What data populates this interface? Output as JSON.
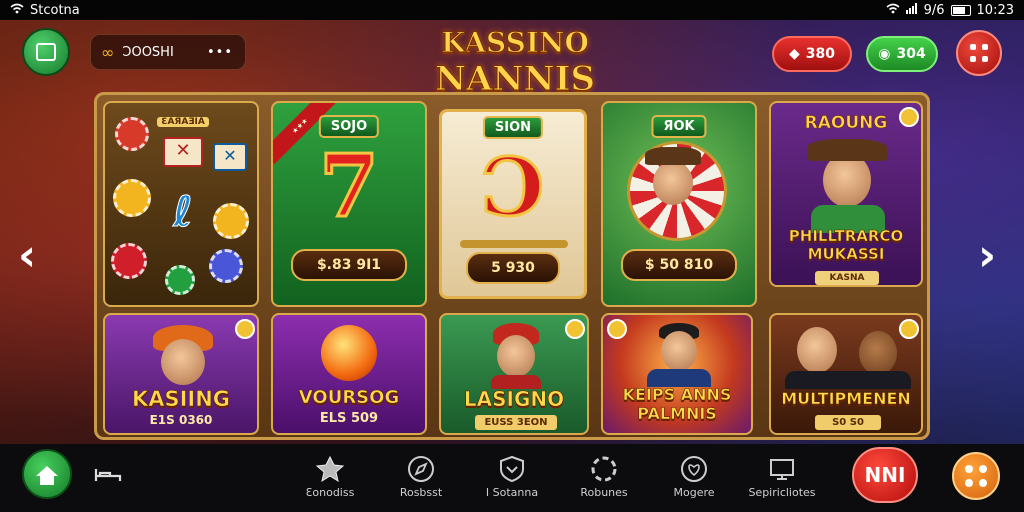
{
  "status_bar": {
    "carrier": "Stcotna",
    "time": "10:23",
    "signal_text": "9/6"
  },
  "top_bar": {
    "balance": "ƆOOSHI",
    "balance_menu": "•••",
    "logo_line1": "KASSINO",
    "logo_line2": "NANNIS",
    "red_pill": "380",
    "green_pill": "304"
  },
  "tiles": [
    {
      "title": "",
      "subtitle": "",
      "sign": "ƐAЯAƎIA"
    },
    {
      "tag": "SOJO",
      "symbol": "7",
      "price": "$.83 9I1"
    },
    {
      "tag": "SION",
      "symbol": "Ɔ",
      "price": "5 930"
    },
    {
      "tag": "ЯOK",
      "price": "$ 50 810"
    },
    {
      "banner": "RAOUNG",
      "title": "PHILLTRARCO MUKASSI",
      "subtitle": "KASNA"
    },
    {
      "title": "KASIING",
      "subtitle": "E1S 0360"
    },
    {
      "title": "VOURSOG",
      "subtitle": "ELS 509"
    },
    {
      "title": "LASIGNO",
      "subtitle": "EUSS 3EON"
    },
    {
      "title": "KEIPS ANNS PALMNIS",
      "subtitle": ""
    },
    {
      "title": "MULTIPMENEN",
      "subtitle": "S0 S0"
    }
  ],
  "bottom_nav": {
    "items": [
      {
        "label": "Ɛonodiss",
        "icon": "star-icon"
      },
      {
        "label": "Rosbsst",
        "icon": "compass-icon"
      },
      {
        "label": "I Sotanna",
        "icon": "shield-icon"
      },
      {
        "label": "Robunes",
        "icon": "refresh-icon"
      },
      {
        "label": "Mogere",
        "icon": "heart-icon"
      },
      {
        "label": "Sepiricliotes",
        "icon": "monitor-icon"
      }
    ],
    "action_button": "NNI"
  },
  "colors": {
    "accent_gold": "#ffd44a",
    "green": "#2b9b3a",
    "red": "#d91f1f",
    "orange": "#f28a1e"
  }
}
